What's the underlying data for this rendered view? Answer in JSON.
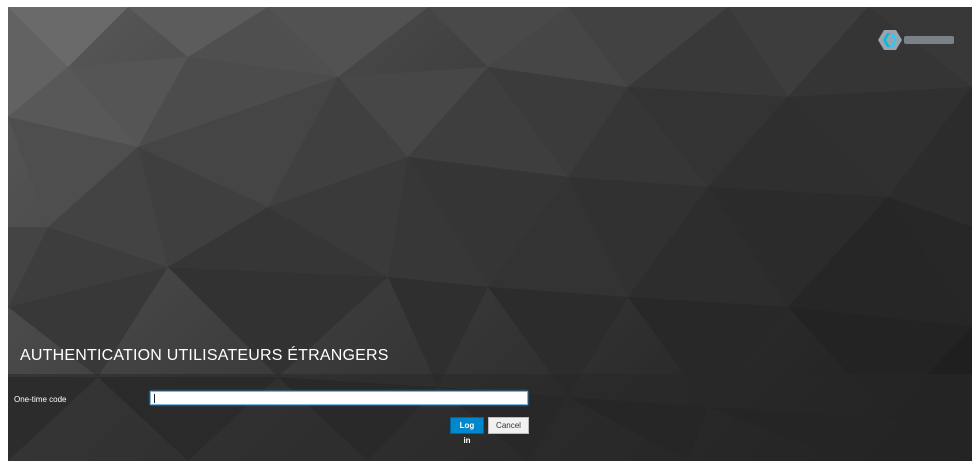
{
  "page": {
    "title": "AUTHENTICATION UTILISATEURS ÉTRANGERS",
    "logo_icon": "keycloak-logo-icon"
  },
  "form": {
    "otp_label": "One-time code",
    "otp_value": "",
    "login_label": "Log in",
    "cancel_label": "Cancel"
  },
  "colors": {
    "primary": "#0088ce",
    "input_focus": "#39a5dc",
    "background": "#2e2e2e"
  }
}
